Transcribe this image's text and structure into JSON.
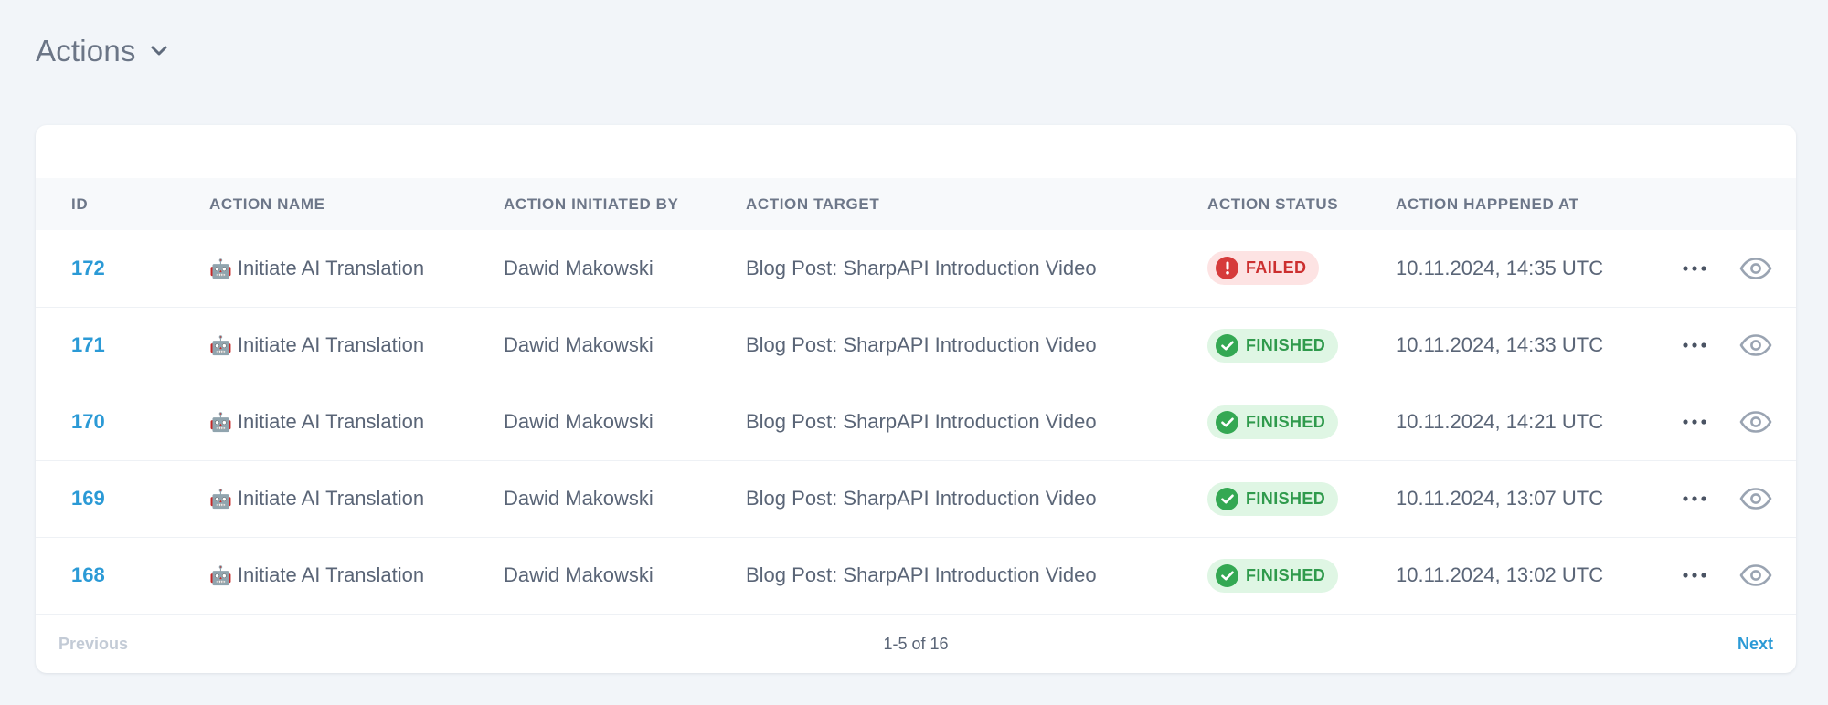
{
  "header": {
    "title": "Actions",
    "menu_icon": "chevron-down-icon"
  },
  "table": {
    "columns": [
      "ID",
      "Action Name",
      "Action Initiated By",
      "Action Target",
      "Action Status",
      "Action Happened At"
    ],
    "rows": [
      {
        "id": "172",
        "emoji": "🤖",
        "name": "Initiate AI Translation",
        "by": "Dawid Makowski",
        "target": "Blog Post: SharpAPI Introduction Video",
        "status": "FAILED",
        "status_type": "failed",
        "at": "10.11.2024, 14:35 UTC"
      },
      {
        "id": "171",
        "emoji": "🤖",
        "name": "Initiate AI Translation",
        "by": "Dawid Makowski",
        "target": "Blog Post: SharpAPI Introduction Video",
        "status": "FINISHED",
        "status_type": "finished",
        "at": "10.11.2024, 14:33 UTC"
      },
      {
        "id": "170",
        "emoji": "🤖",
        "name": "Initiate AI Translation",
        "by": "Dawid Makowski",
        "target": "Blog Post: SharpAPI Introduction Video",
        "status": "FINISHED",
        "status_type": "finished",
        "at": "10.11.2024, 14:21 UTC"
      },
      {
        "id": "169",
        "emoji": "🤖",
        "name": "Initiate AI Translation",
        "by": "Dawid Makowski",
        "target": "Blog Post: SharpAPI Introduction Video",
        "status": "FINISHED",
        "status_type": "finished",
        "at": "10.11.2024, 13:07 UTC"
      },
      {
        "id": "168",
        "emoji": "🤖",
        "name": "Initiate AI Translation",
        "by": "Dawid Makowski",
        "target": "Blog Post: SharpAPI Introduction Video",
        "status": "FINISHED",
        "status_type": "finished",
        "at": "10.11.2024, 13:02 UTC"
      }
    ]
  },
  "pagination": {
    "previous_label": "Previous",
    "range_label": "1-5 of 16",
    "next_label": "Next"
  },
  "colors": {
    "link": "#2b9ad6",
    "failed": "#d63b3b",
    "finished": "#34a853",
    "background": "#f2f5f9"
  }
}
